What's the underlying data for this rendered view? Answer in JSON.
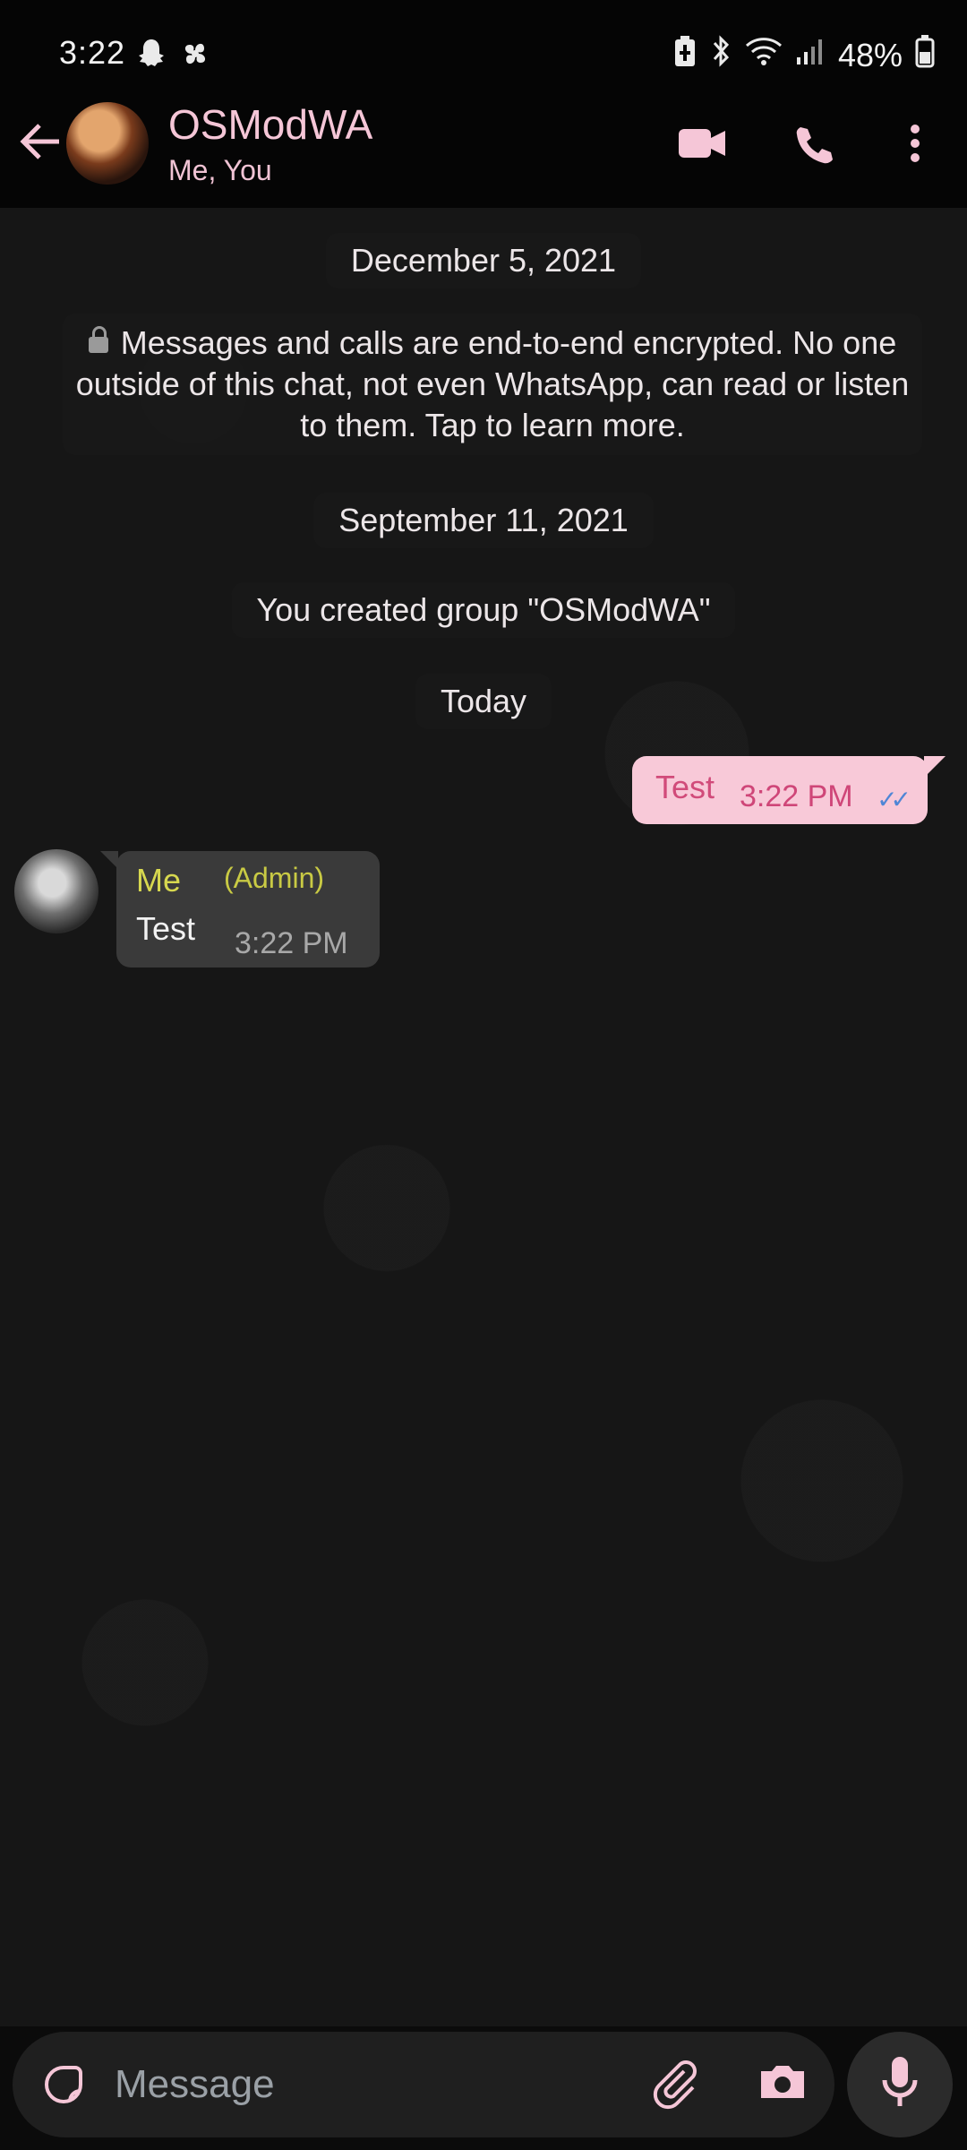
{
  "status_bar": {
    "time": "3:22",
    "battery": "48%",
    "left_icons": [
      "snapchat-icon",
      "fan-icon"
    ],
    "right_icons": [
      "battery-saver-icon",
      "bluetooth-icon",
      "wifi-icon",
      "signal-icon",
      "battery-icon"
    ]
  },
  "header": {
    "title": "OSModWA",
    "subtitle": "Me, You"
  },
  "chat": {
    "dates": [
      "December 5, 2021",
      "September 11, 2021",
      "Today"
    ],
    "encryption_notice": "Messages and calls are end-to-end encrypted. No one outside of this chat, not even WhatsApp, can read or listen to them. Tap to learn more.",
    "system_message": "You created group \"OSModWA\"",
    "outgoing": {
      "text": "Test",
      "time": "3:22 PM"
    },
    "incoming": {
      "sender": "Me",
      "role": "(Admin)",
      "text": "Test",
      "time": "3:22 PM"
    }
  },
  "input": {
    "placeholder": "Message"
  },
  "colors": {
    "accent_pink": "#f8c9d8",
    "header_text": "#f5c6d7",
    "admin_yellow": "#d7d84f",
    "read_ticks": "#4f86d6"
  }
}
